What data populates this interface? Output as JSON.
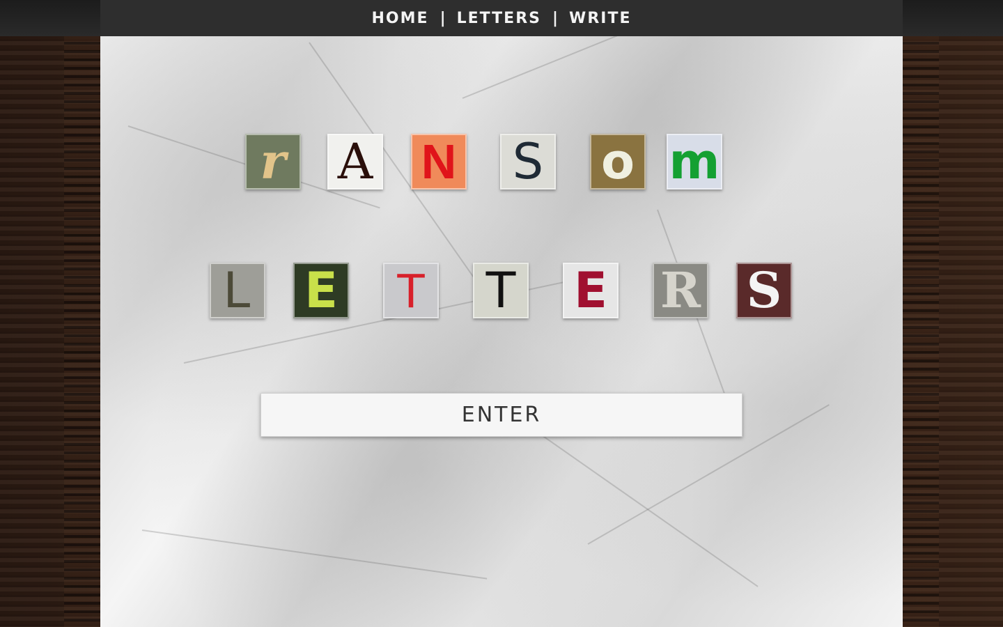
{
  "nav": {
    "home_label": "HOME",
    "letters_label": "LETTERS",
    "write_label": "WRITE",
    "separator": "|"
  },
  "title": {
    "row1": [
      {
        "char": "r",
        "bg": "#6f7a5f",
        "fg": "#e2c48a"
      },
      {
        "char": "A",
        "bg": "#f1f1ee",
        "fg": "#2a0f0a"
      },
      {
        "char": "N",
        "bg": "#f08a5a",
        "fg": "#e0141a"
      },
      {
        "char": "S",
        "bg": "#dcdcd6",
        "fg": "#1f2a35"
      },
      {
        "char": "o",
        "bg": "#8a7340",
        "fg": "#f0f0e0"
      },
      {
        "char": "m",
        "bg": "#d8dde8",
        "fg": "#14a032"
      }
    ],
    "row2": [
      {
        "char": "L",
        "bg": "#9e9e98",
        "fg": "#4c4a38"
      },
      {
        "char": "E",
        "bg": "#2e3b24",
        "fg": "#c9e04a"
      },
      {
        "char": "T",
        "bg": "#c9c9cc",
        "fg": "#d8202a"
      },
      {
        "char": "T",
        "bg": "#d5d6cc",
        "fg": "#111111"
      },
      {
        "char": "E",
        "bg": "#e6e6e6",
        "fg": "#a01030"
      },
      {
        "char": "R",
        "bg": "#8a8a84",
        "fg": "#d6d4cc"
      },
      {
        "char": "S",
        "bg": "#5a2a2a",
        "fg": "#f4f4f4"
      }
    ]
  },
  "enter_button": {
    "label": "ENTER"
  }
}
